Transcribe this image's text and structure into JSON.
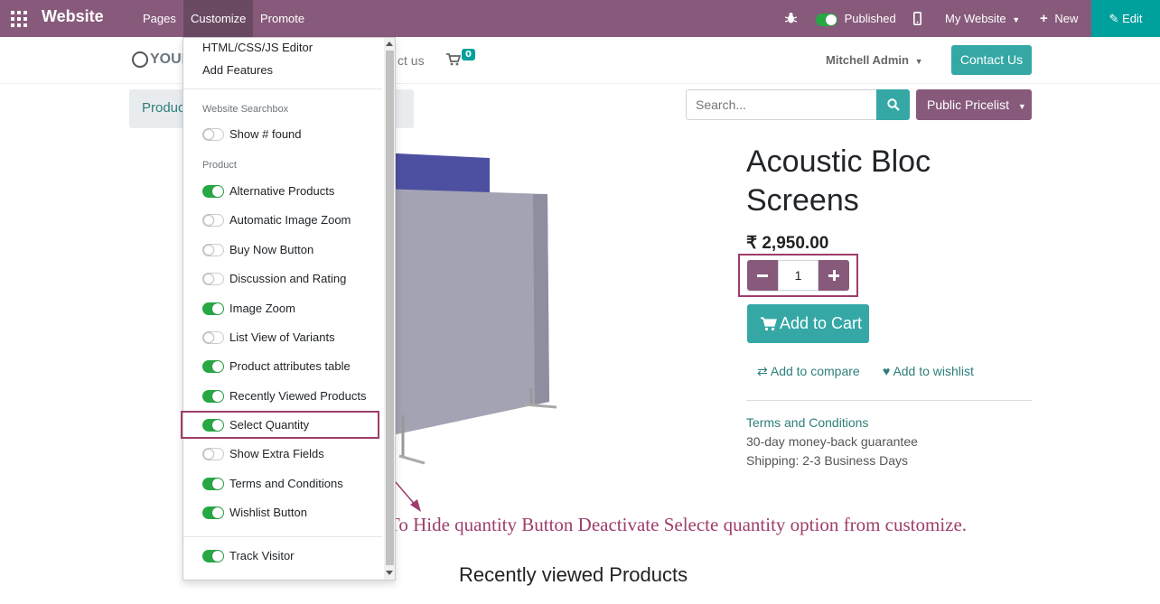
{
  "topbar": {
    "brand": "Website",
    "menus": [
      "Pages",
      "Customize",
      "Promote"
    ],
    "published_label": "Published",
    "my_website": "My Website",
    "new_label": "New",
    "edit_label": "Edit"
  },
  "site": {
    "logo_text": "YOUR",
    "nav_partial": "ct us",
    "cart_count": "0",
    "user": "Mitchell Admin",
    "contact_label": "Contact Us"
  },
  "breadcrumb": {
    "label": "Produc"
  },
  "search": {
    "placeholder": "Search..."
  },
  "pricelist": {
    "label": "Public Pricelist"
  },
  "product": {
    "title": "Acoustic Bloc Screens",
    "price": "₹ 2,950.00",
    "quantity": "1",
    "add_to_cart": "Add to Cart",
    "add_to_compare": "Add to compare",
    "add_to_wishlist": "Add to wishlist",
    "terms": "Terms and Conditions",
    "guarantee": "30-day money-back guarantee",
    "shipping": "Shipping: 2-3 Business Days"
  },
  "annotation": "To Hide quantity Button Deactivate Selecte quantity option from customize.",
  "recently_viewed": "Recently viewed Products",
  "dropdown": {
    "top_items": [
      "HTML/CSS/JS Editor",
      "Add Features"
    ],
    "searchbox_header": "Website Searchbox",
    "show_found": "Show # found",
    "product_header": "Product",
    "options": [
      {
        "label": "Alternative Products",
        "on": true
      },
      {
        "label": "Automatic Image Zoom",
        "on": false
      },
      {
        "label": "Buy Now Button",
        "on": false
      },
      {
        "label": "Discussion and Rating",
        "on": false
      },
      {
        "label": "Image Zoom",
        "on": true
      },
      {
        "label": "List View of Variants",
        "on": false
      },
      {
        "label": "Product attributes table",
        "on": true
      },
      {
        "label": "Recently Viewed Products",
        "on": true
      },
      {
        "label": "Select Quantity",
        "on": true
      },
      {
        "label": "Show Extra Fields",
        "on": false
      },
      {
        "label": "Terms and Conditions",
        "on": true
      },
      {
        "label": "Wishlist Button",
        "on": true
      }
    ],
    "track_visitor": "Track Visitor"
  }
}
